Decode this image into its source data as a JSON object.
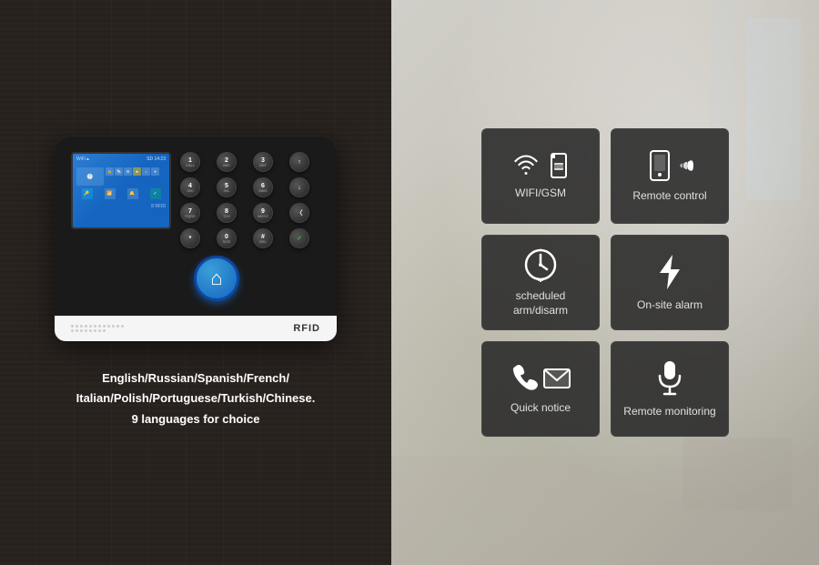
{
  "left": {
    "languages_line1": "English/Russian/Spanish/French/",
    "languages_line2": "Italian/Polish/Portuguese/Turkish/Chinese.",
    "languages_line3": "9 languages for choice",
    "device": {
      "rfid_label": "RFID",
      "lcd": {
        "time": "14:23",
        "signal": "WiFi"
      }
    },
    "keypad_keys": [
      {
        "main": "1",
        "sub": "CALL"
      },
      {
        "main": "2",
        "sub": "ABC"
      },
      {
        "main": "3",
        "sub": "DEF"
      },
      {
        "main": "↑",
        "sub": ""
      },
      {
        "main": "4",
        "sub": "GHI"
      },
      {
        "main": "5",
        "sub": "JKL"
      },
      {
        "main": "6",
        "sub": "MNO"
      },
      {
        "main": "↓",
        "sub": ""
      },
      {
        "main": "7",
        "sub": "PQRS"
      },
      {
        "main": "8",
        "sub": "TUV"
      },
      {
        "main": "9",
        "sub": "WXYZ"
      },
      {
        "main": "〈",
        "sub": ""
      },
      {
        "main": "*",
        "sub": ""
      },
      {
        "main": "0",
        "sub": "SOS"
      },
      {
        "main": "#",
        "sub": "DELETE"
      },
      {
        "main": "✓",
        "sub": ""
      }
    ]
  },
  "right": {
    "features": [
      {
        "id": "wifi-gsm",
        "label": "WIFI/GSM",
        "icon_type": "wifi-gsm"
      },
      {
        "id": "remote-control",
        "label": "Remote control",
        "icon_type": "remote-control"
      },
      {
        "id": "scheduled-arm",
        "label": "scheduled arm/disarm",
        "icon_type": "clock"
      },
      {
        "id": "on-site-alarm",
        "label": "On-site alarm",
        "icon_type": "lightning"
      },
      {
        "id": "quick-notice",
        "label": "Quick notice",
        "icon_type": "phone-email"
      },
      {
        "id": "remote-monitoring",
        "label": "Remote monitoring",
        "icon_type": "microphone"
      }
    ]
  }
}
